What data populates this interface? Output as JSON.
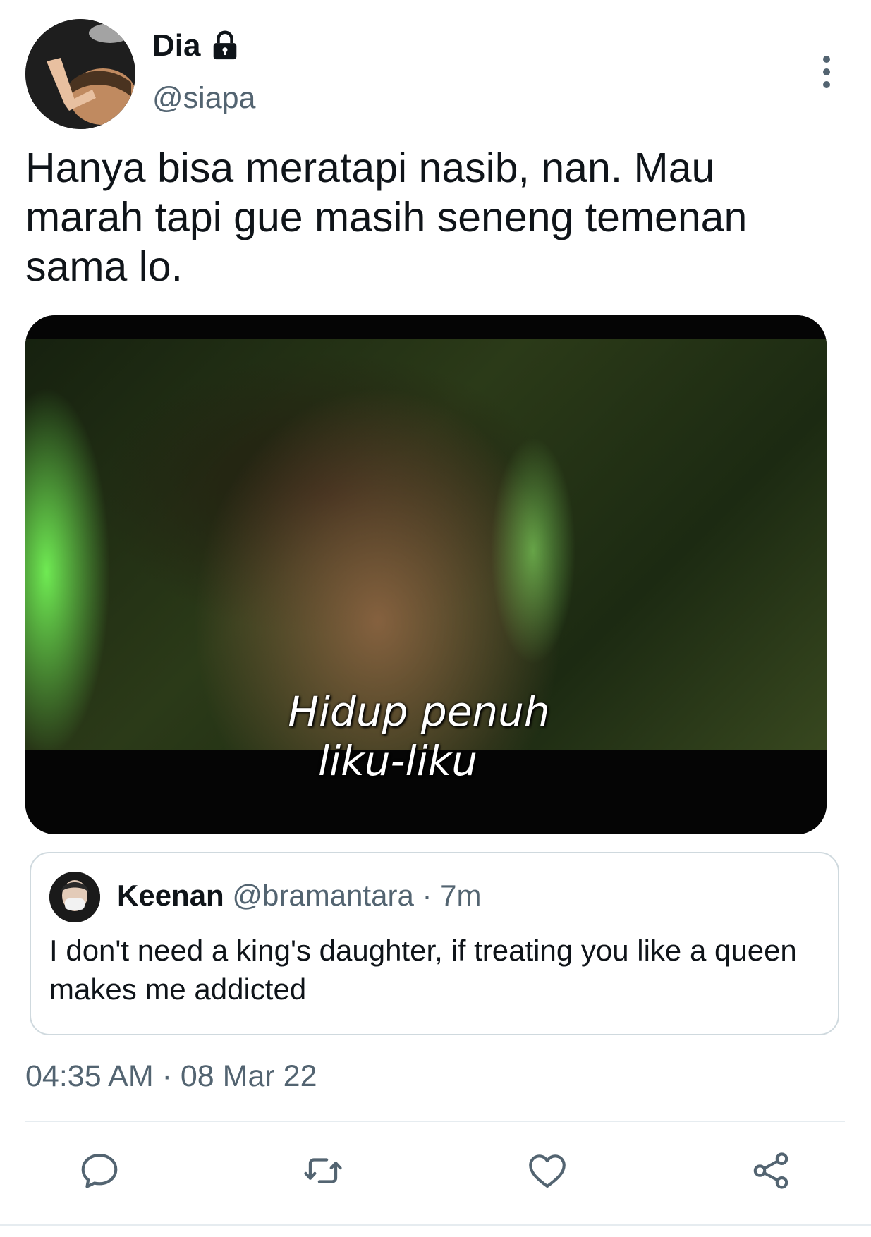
{
  "author": {
    "display_name": "Dia",
    "handle": "@siapa"
  },
  "tweet": {
    "text": "Hanya bisa meratapi nasib, nan. Mau\nmarah tapi gue masih seneng temenan\nsama lo.",
    "timestamp": "04:35 AM · 08 Mar 22"
  },
  "media": {
    "caption_line1": "Hidup penuh",
    "caption_line2": "liku-liku"
  },
  "quoted_tweet": {
    "name": "Keenan",
    "meta": "@bramantara · 7m",
    "text": "I don't need a king's daughter, if treating you like a queen makes me addicted"
  },
  "icons": {
    "lock": "lock-icon",
    "more": "more-vertical-icon",
    "reply": "reply-icon",
    "retweet": "retweet-icon",
    "like": "heart-icon",
    "share": "share-icon"
  },
  "colors": {
    "text_primary": "#0f1419",
    "text_secondary": "#536471",
    "border": "#cfd9de",
    "icon": "#536471"
  }
}
